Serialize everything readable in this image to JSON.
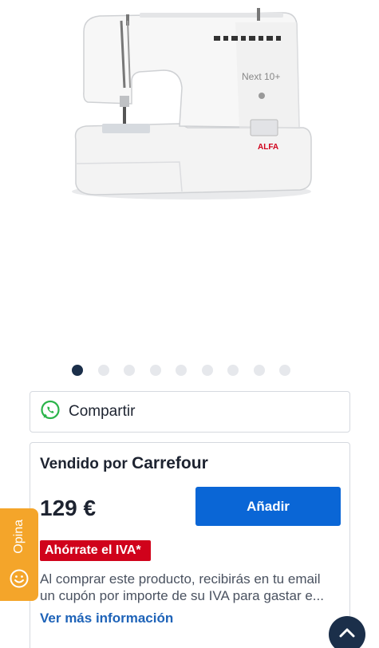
{
  "product": {
    "image_alt": "Sewing machine",
    "model_label": "Next 10+",
    "brand_label": "ALFA"
  },
  "gallery": {
    "total_images": 9,
    "active_index": 0
  },
  "share": {
    "label": "Compartir",
    "icon": "whatsapp-icon"
  },
  "seller": {
    "sold_by_prefix": "Vendido por",
    "seller_name": "Carrefour"
  },
  "pricing": {
    "price": "129 €",
    "add_button": "Añadir"
  },
  "iva": {
    "badge": "Ahórrate el IVA*",
    "line1": "Al comprar este producto, recibirás en tu email",
    "line2": "un cupón por importe de su IVA para gastar e...",
    "more_link": "Ver más información"
  },
  "feedback": {
    "label": "Opina",
    "icon": "smiley-icon"
  },
  "scroll": {
    "icon": "chevron-up-icon"
  },
  "colors": {
    "primary_button": "#0a66d6",
    "badge_red": "#d0021b",
    "link_blue": "#1e63b8",
    "feedback_orange": "#f4a52a",
    "dark_navy": "#1b2f4a"
  }
}
